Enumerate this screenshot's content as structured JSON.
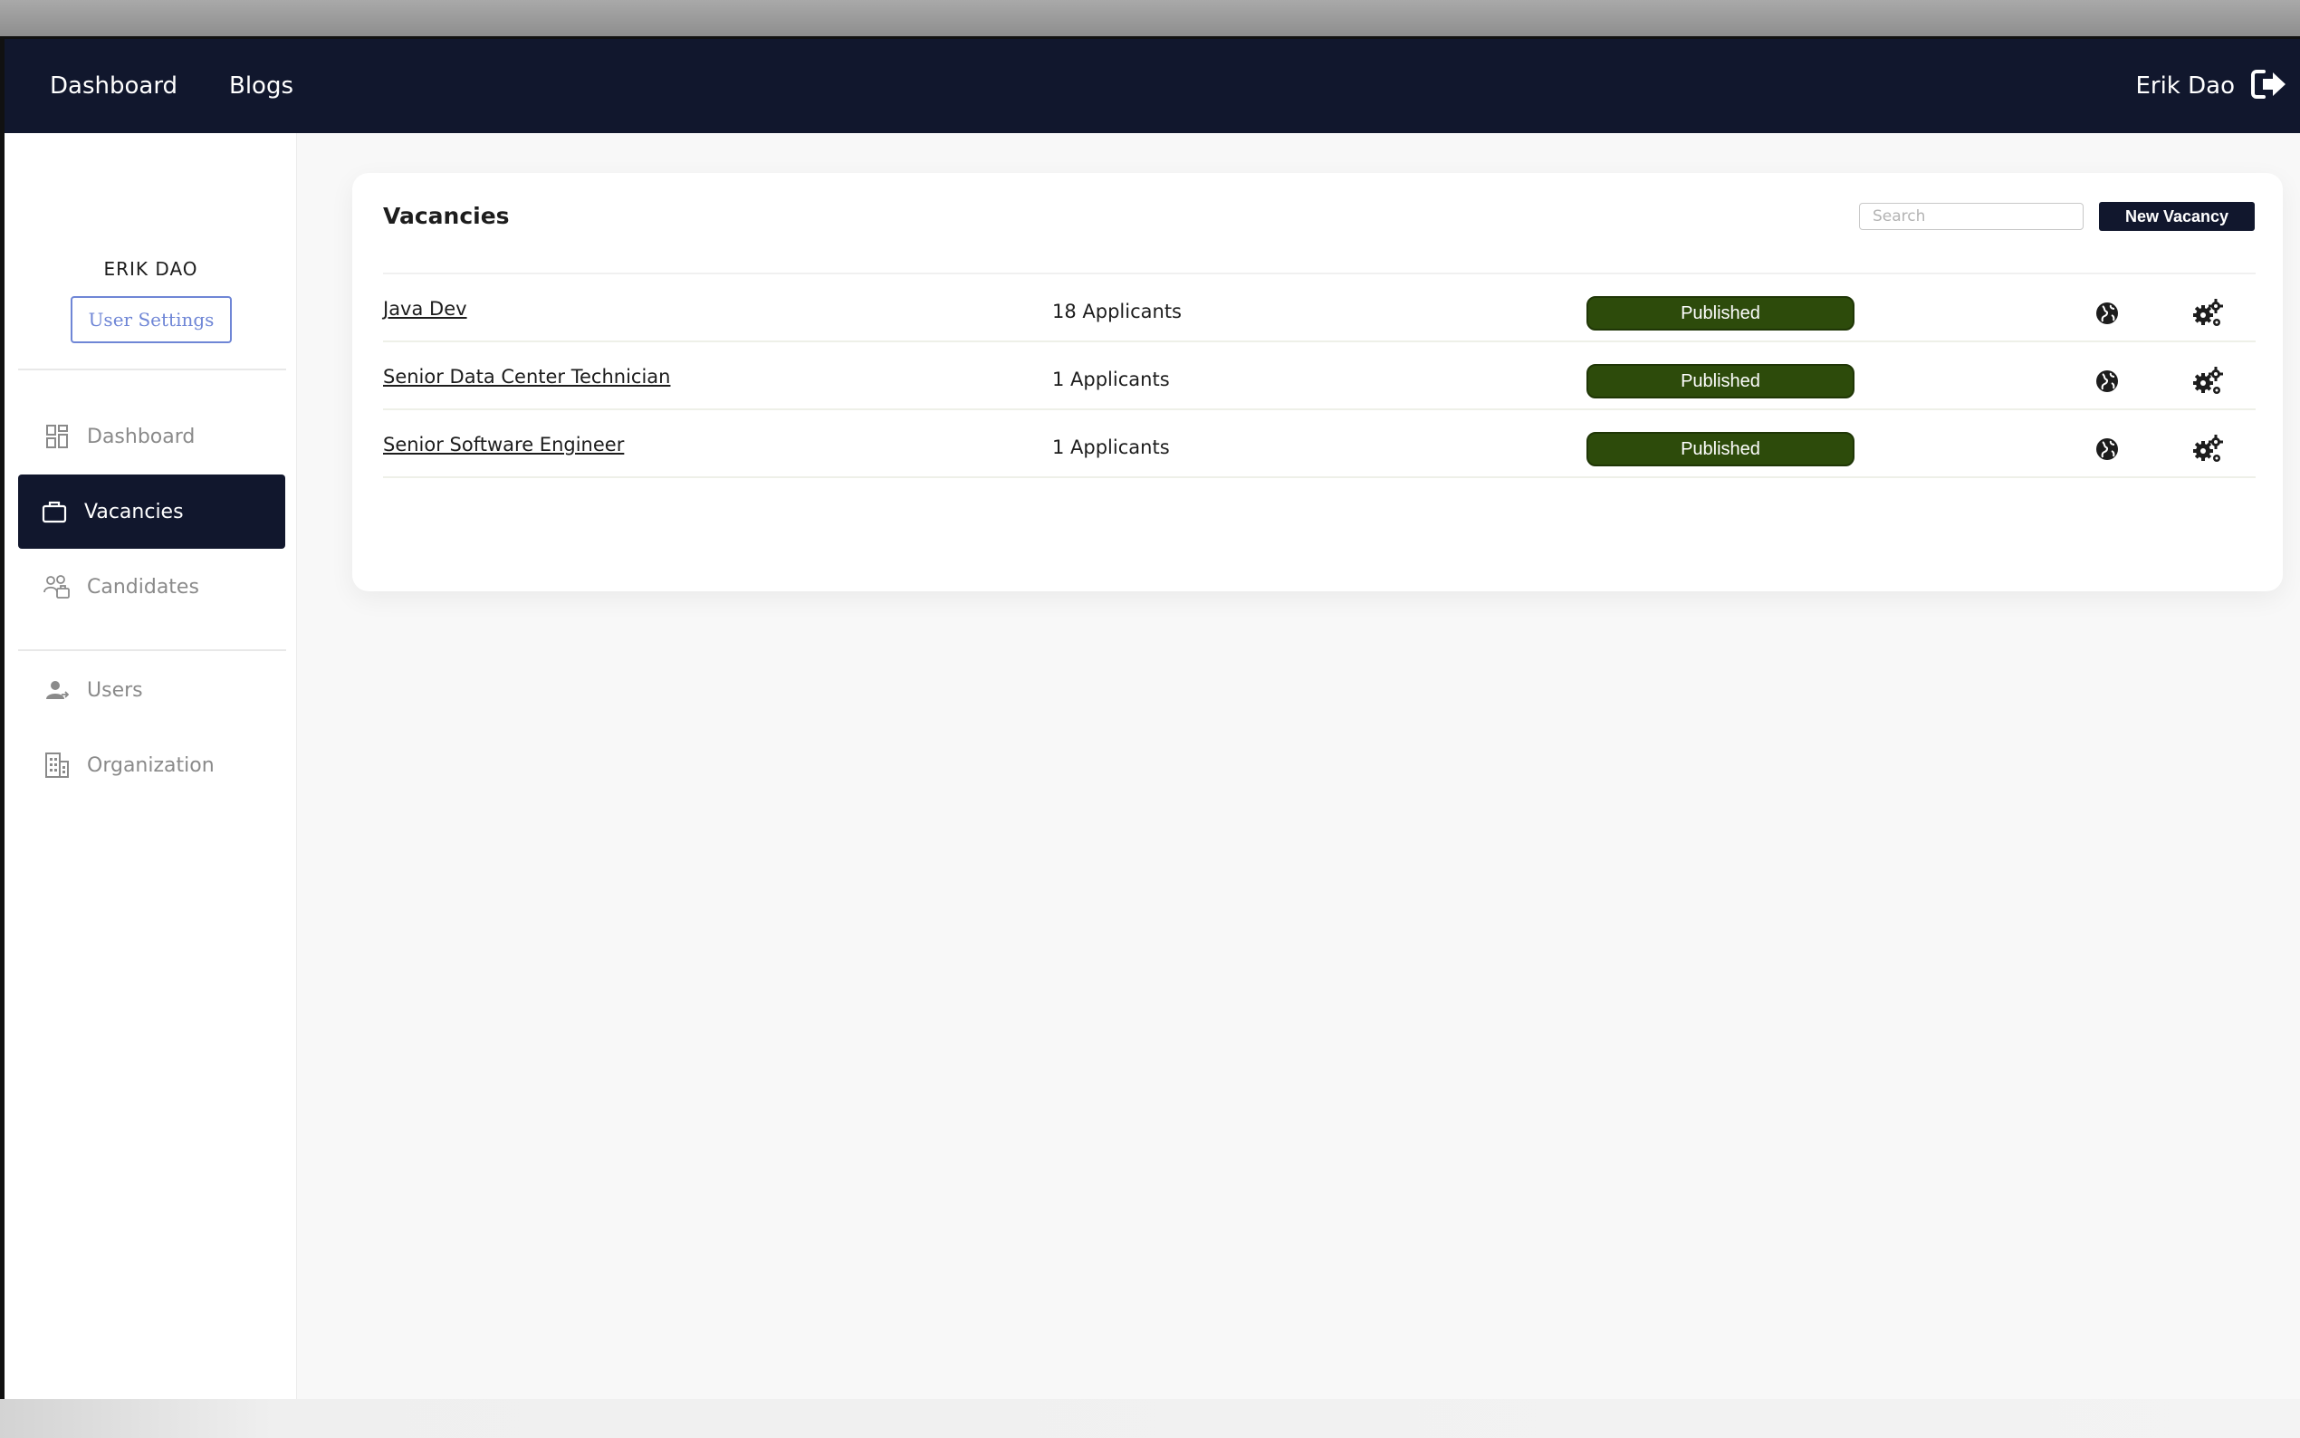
{
  "topbar": {
    "nav": [
      {
        "label": "Dashboard"
      },
      {
        "label": "Blogs"
      }
    ],
    "user_name": "Erik Dao",
    "logout_icon": "sign-out-icon"
  },
  "sidebar": {
    "username": "ERIK DAO",
    "settings_label": "User Settings",
    "items": [
      {
        "label": "Dashboard",
        "icon": "grid-icon",
        "active": false
      },
      {
        "label": "Vacancies",
        "icon": "briefcase-icon",
        "active": true
      },
      {
        "label": "Candidates",
        "icon": "candidates-icon",
        "active": false
      },
      {
        "label": "Users",
        "icon": "user-icon",
        "active": false
      },
      {
        "label": "Organization",
        "icon": "building-icon",
        "active": false
      }
    ]
  },
  "vacancies": {
    "title": "Vacancies",
    "search_placeholder": "Search",
    "new_button": "New Vacancy",
    "rows": [
      {
        "title": "Java Dev",
        "applicants": "18 Applicants",
        "status": "Published"
      },
      {
        "title": "Senior Data Center Technician",
        "applicants": "1 Applicants",
        "status": "Published"
      },
      {
        "title": "Senior Software Engineer",
        "applicants": "1 Applicants",
        "status": "Published"
      }
    ]
  },
  "colors": {
    "nav_bg": "#11172d",
    "published_badge": "#2d4b0b",
    "settings_border": "#6f86d6"
  }
}
